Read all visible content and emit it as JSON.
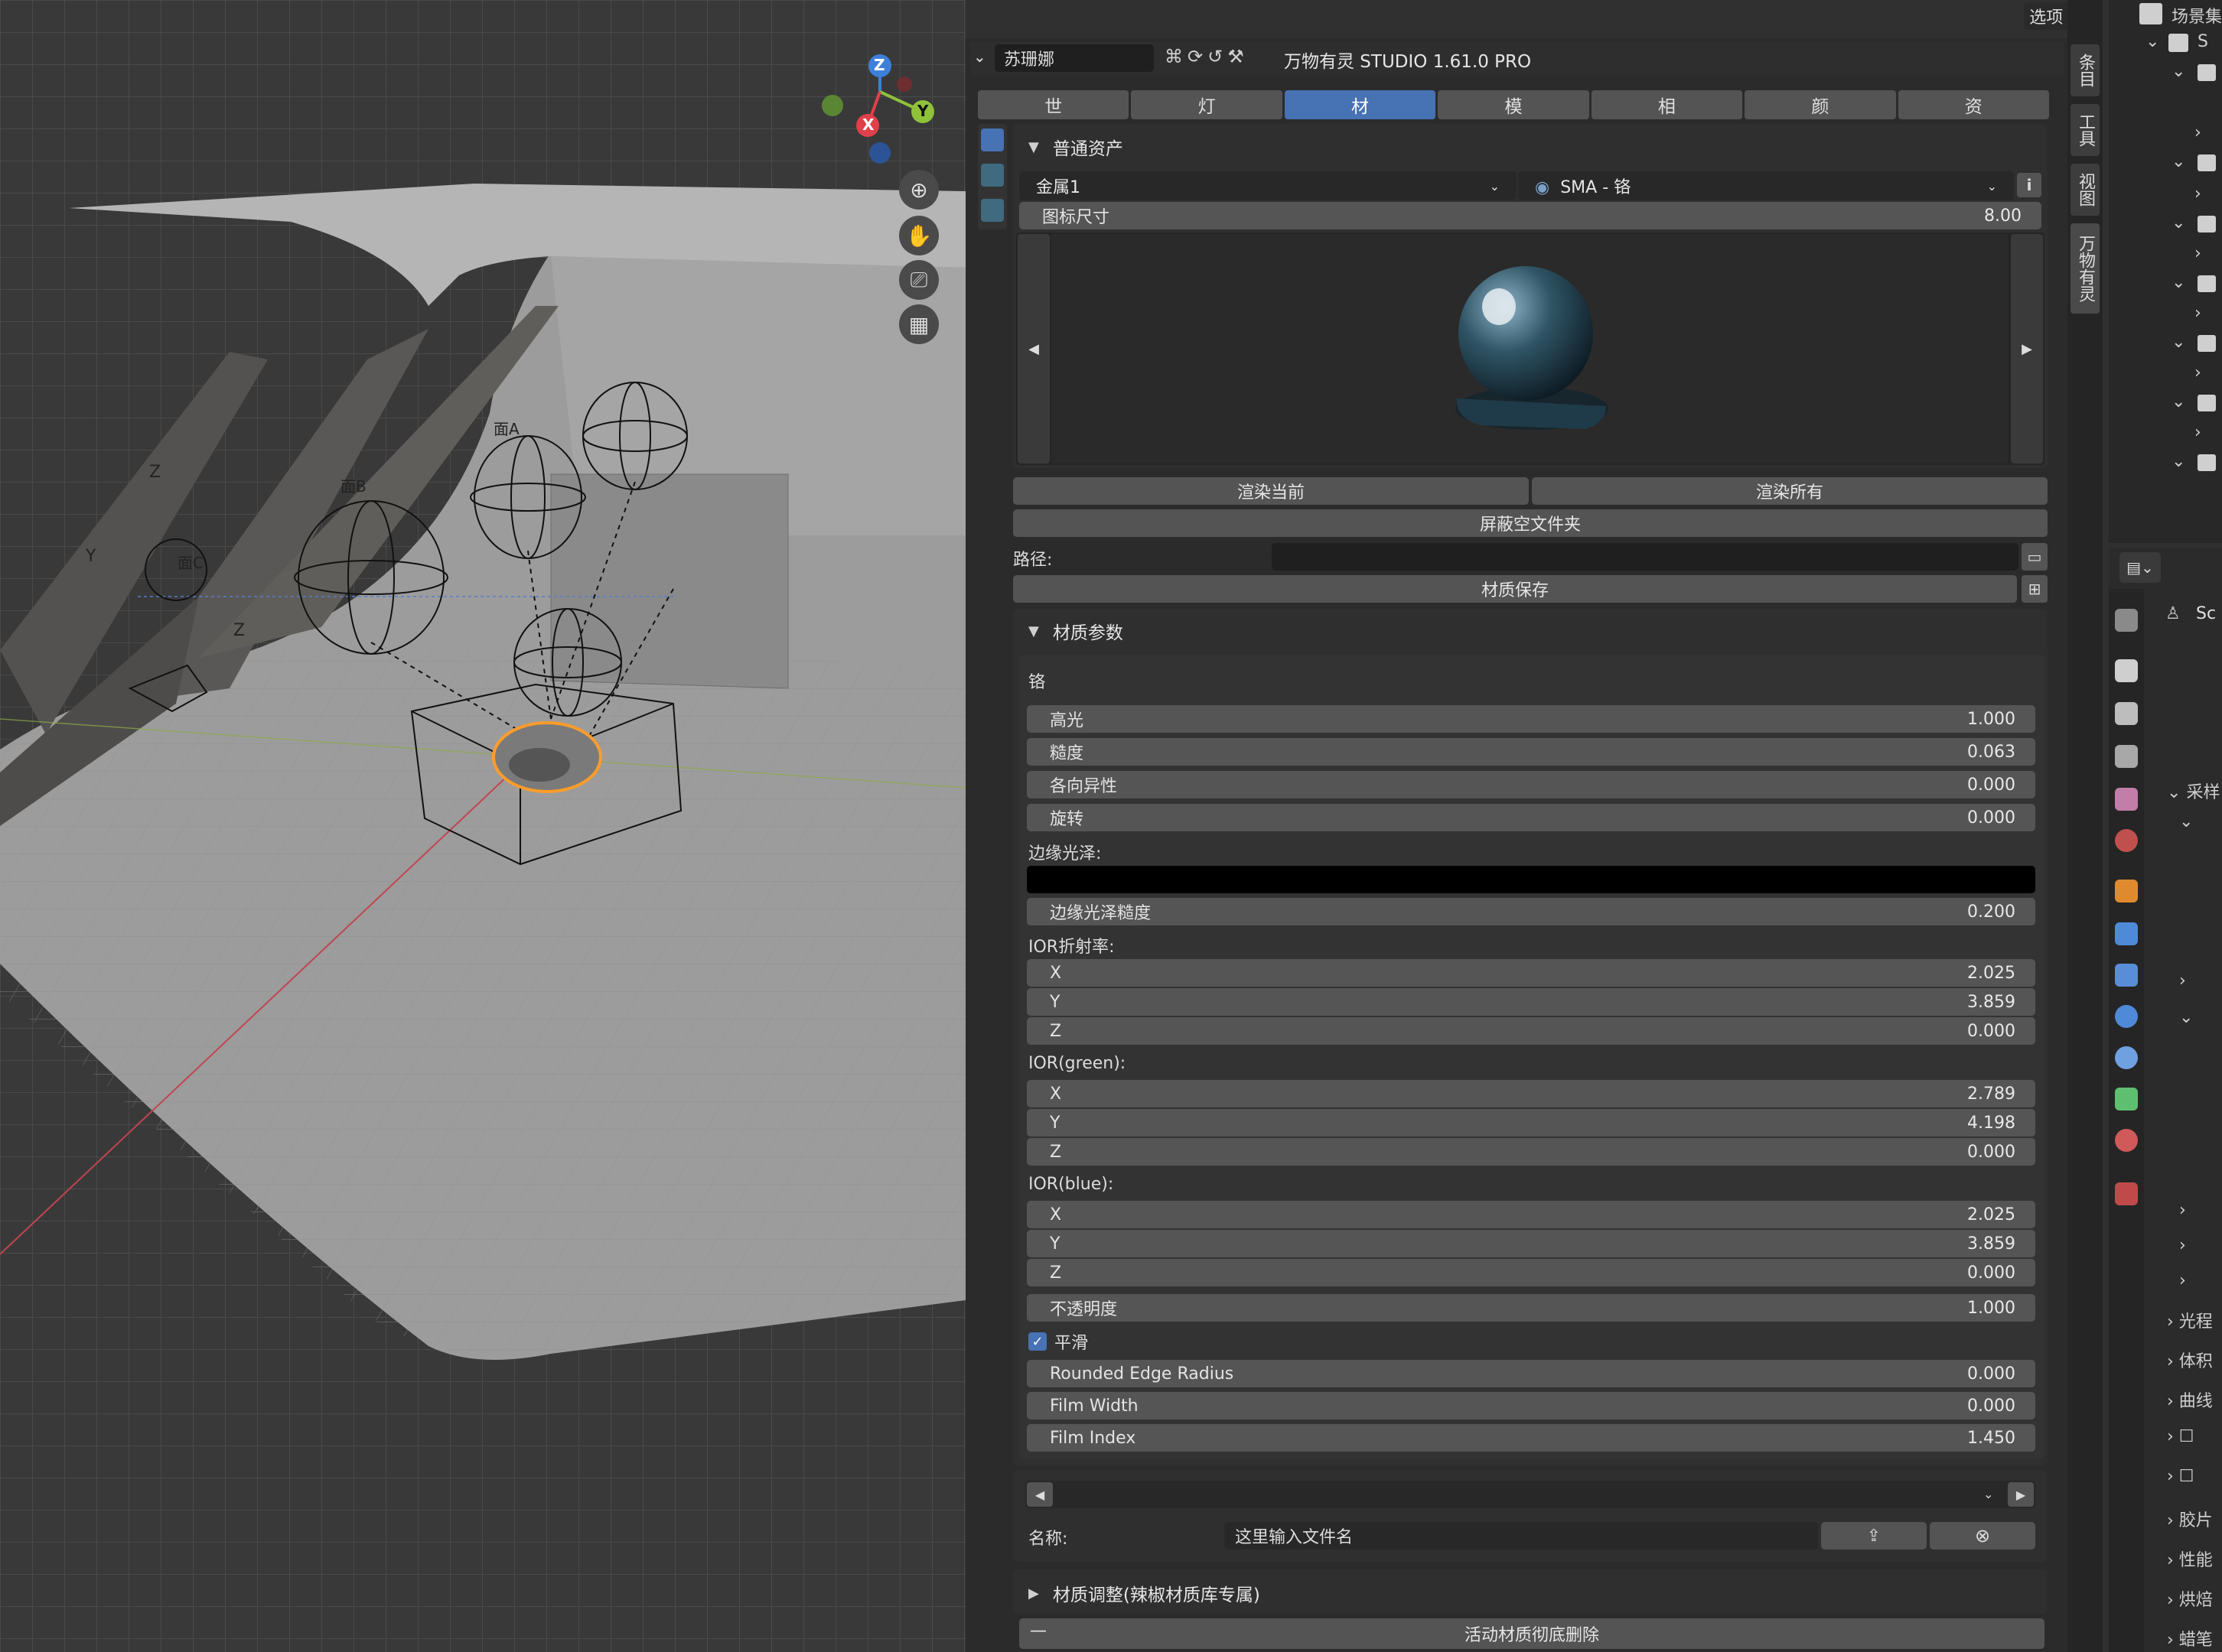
{
  "header": {
    "object_name": "苏珊娜",
    "addon_title": "万物有灵 STUDIO 1.61.0 PRO",
    "options_label": "选项"
  },
  "tabs": [
    "世",
    "灯",
    "材",
    "模",
    "相",
    "颜",
    "资"
  ],
  "active_tab": "材",
  "asset_section": {
    "title": "普通资产",
    "category": "金属1",
    "material": "SMA - 铬",
    "icon_size_label": "图标尺寸",
    "icon_size_value": "8.00",
    "render_current": "渲染当前",
    "render_all": "渲染所有",
    "hide_empty": "屏蔽空文件夹",
    "path_label": "路径:",
    "path_value": "",
    "save_label": "材质保存"
  },
  "material_section": {
    "title": "材质参数",
    "material_name": "铬",
    "specular": {
      "label": "高光",
      "value": "1.000"
    },
    "roughness": {
      "label": "糙度",
      "value": "0.063"
    },
    "anisotropy": {
      "label": "各向异性",
      "value": "0.000"
    },
    "rotation": {
      "label": "旋转",
      "value": "0.000"
    },
    "edge_tint_label": "边缘光泽:",
    "edge_tint_color": "#000000",
    "edge_roughness": {
      "label": "边缘光泽糙度",
      "value": "0.200"
    },
    "ior_red_label": "IOR折射率:",
    "ior_red": [
      {
        "axis": "X",
        "value": "2.025"
      },
      {
        "axis": "Y",
        "value": "3.859"
      },
      {
        "axis": "Z",
        "value": "0.000"
      }
    ],
    "ior_green_label": "IOR(green):",
    "ior_green": [
      {
        "axis": "X",
        "value": "2.789"
      },
      {
        "axis": "Y",
        "value": "4.198"
      },
      {
        "axis": "Z",
        "value": "0.000"
      }
    ],
    "ior_blue_label": "IOR(blue):",
    "ior_blue": [
      {
        "axis": "X",
        "value": "2.025"
      },
      {
        "axis": "Y",
        "value": "3.859"
      },
      {
        "axis": "Z",
        "value": "0.000"
      }
    ],
    "opacity": {
      "label": "不透明度",
      "value": "1.000"
    },
    "smooth_label": "平滑",
    "smooth_checked": true,
    "rounded_edge": {
      "label": "Rounded Edge Radius",
      "value": "0.000"
    },
    "film_width": {
      "label": "Film Width",
      "value": "0.000"
    },
    "film_index": {
      "label": "Film Index",
      "value": "1.450"
    }
  },
  "file_row": {
    "name_label": "名称:",
    "name_placeholder": "这里输入文件名"
  },
  "adjust_section": {
    "title": "材质调整(辣椒材质库专属)"
  },
  "delete_label": "活动材质彻底删除",
  "side_tabs": [
    "条目",
    "工具",
    "视图",
    "万物有灵"
  ],
  "outliner": {
    "title": "场景集",
    "first_item": "S"
  },
  "properties": {
    "scene_label": "Sc",
    "sections": [
      "采样",
      "光程",
      "体积",
      "曲线",
      "胶片",
      "性能",
      "烘焙",
      "蜡笔"
    ]
  },
  "viewport": {
    "gizmo_axes": [
      "X",
      "Y",
      "Z"
    ],
    "object_labels": [
      "面C",
      "面B",
      "面A"
    ],
    "axis_letters": [
      "Z",
      "Y",
      "Z",
      "Z",
      "Z",
      "Z"
    ]
  },
  "colors": {
    "accent": "#4772b3",
    "selection": "#ffa030",
    "x_axis": "#e0404a",
    "y_axis": "#8fc13b",
    "z_axis": "#3d80d9"
  }
}
